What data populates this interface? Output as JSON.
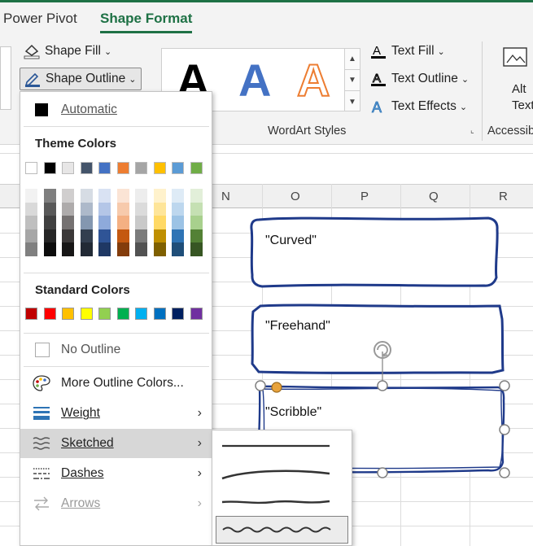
{
  "tabs": [
    {
      "label": "Power Pivot",
      "active": false
    },
    {
      "label": "Shape Format",
      "active": true
    }
  ],
  "ribbon": {
    "shape_fill": "Shape Fill",
    "shape_outline": "Shape Outline",
    "text_fill": "Text Fill",
    "text_outline": "Text Outline",
    "text_effects": "Text Effects",
    "wordart_letter": "A",
    "wordart_group": "WordArt Styles",
    "alt_text_line1": "Alt",
    "alt_text_line2": "Text",
    "accessibility_group": "Accessib"
  },
  "columns": [
    "N",
    "O",
    "P",
    "Q",
    "R"
  ],
  "shapes": [
    {
      "text": "\"Curved\"",
      "style": "curved"
    },
    {
      "text": "\"Freehand\"",
      "style": "freehand"
    },
    {
      "text": "\"Scribble\"",
      "style": "scribble"
    }
  ],
  "menu": {
    "automatic": "Automatic",
    "theme_colors_heading": "Theme Colors",
    "standard_colors_heading": "Standard Colors",
    "no_outline": "No Outline",
    "more_colors": "More Outline Colors...",
    "weight": "Weight",
    "sketched": "Sketched",
    "dashes": "Dashes",
    "arrows": "Arrows"
  },
  "theme_colors": [
    "#ffffff",
    "#000000",
    "#e7e6e6",
    "#44546a",
    "#4472c4",
    "#ed7d31",
    "#a5a5a5",
    "#ffc000",
    "#5b9bd5",
    "#70ad47"
  ],
  "theme_shades": [
    [
      "#f2f2f2",
      "#d9d9d9",
      "#bfbfbf",
      "#a6a6a6",
      "#808080"
    ],
    [
      "#7f7f7f",
      "#595959",
      "#404040",
      "#262626",
      "#0d0d0d"
    ],
    [
      "#d0cece",
      "#aeabab",
      "#757171",
      "#3b3838",
      "#171616"
    ],
    [
      "#d6dce4",
      "#adb9ca",
      "#8497b0",
      "#333f4f",
      "#222a35"
    ],
    [
      "#d9e2f3",
      "#b4c6e7",
      "#8eaadb",
      "#2f5496",
      "#1f3864"
    ],
    [
      "#fbe4d5",
      "#f7caac",
      "#f4b083",
      "#c45911",
      "#833c0b"
    ],
    [
      "#ededed",
      "#dbdbdb",
      "#c9c9c9",
      "#7b7b7b",
      "#525252"
    ],
    [
      "#fff2cc",
      "#fee599",
      "#ffd965",
      "#bf8f00",
      "#7f6000"
    ],
    [
      "#deebf6",
      "#bdd7ee",
      "#9cc3e5",
      "#2e74b5",
      "#1f4e79"
    ],
    [
      "#e2efd9",
      "#c5e0b3",
      "#a8d08d",
      "#538135",
      "#375623"
    ]
  ],
  "standard_colors": [
    "#c00000",
    "#ff0000",
    "#ffc000",
    "#ffff00",
    "#92d050",
    "#00b050",
    "#00b0f0",
    "#0070c0",
    "#002060",
    "#7030a0"
  ],
  "sketched_styles": [
    "none",
    "curved",
    "freehand",
    "scribble"
  ],
  "selected_sketch": "scribble",
  "colors": {
    "accent": "#1e7145",
    "outline": "#1f3a8a",
    "handle": "#e8a33d"
  }
}
